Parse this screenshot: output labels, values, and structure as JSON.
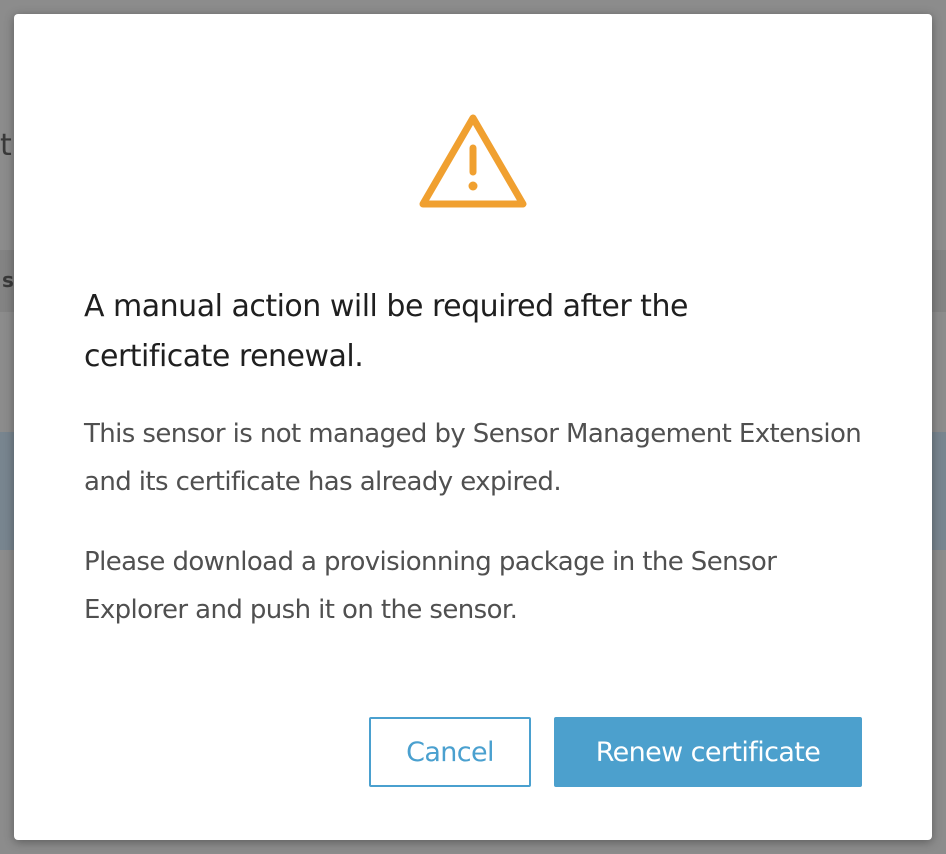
{
  "background": {
    "fragment_1": "t",
    "fragment_2": "s"
  },
  "modal": {
    "icon": "warning-triangle-icon",
    "icon_color": "#f0a030",
    "title": "A manual action will be required after the certificate renewal.",
    "paragraphs": [
      "This sensor is not managed by Sensor Management Extension and its certificate has already expired.",
      "Please download a provisionning package in the Sensor Explorer and push it on the sensor."
    ],
    "buttons": {
      "cancel_label": "Cancel",
      "confirm_label": "Renew certificate"
    },
    "accent_color": "#4ca0cd"
  }
}
